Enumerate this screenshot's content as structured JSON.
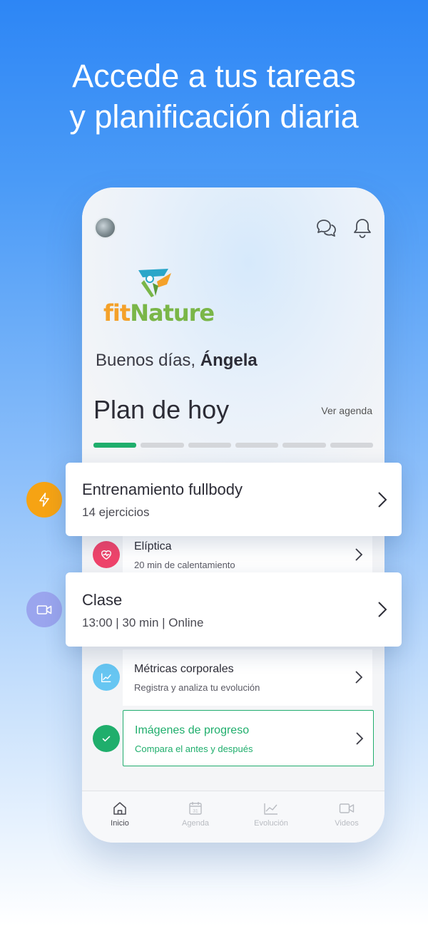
{
  "headline": {
    "line1": "Accede a tus tareas",
    "line2": "y planificación diaria"
  },
  "header": {
    "avatar": "avatar",
    "chat_icon": "chat-bubbles-icon",
    "bell_icon": "bell-icon"
  },
  "brand": {
    "logo_fit": "fit",
    "logo_nature": "Nature",
    "colors": {
      "orange": "#f4a12a",
      "green": "#7ab648",
      "teal": "#2aa6c9"
    }
  },
  "greeting": {
    "prefix": "Buenos días, ",
    "name": "Ángela"
  },
  "plan": {
    "title": "Plan de hoy",
    "link": "Ver agenda",
    "progress_total": 6,
    "progress_done": 1,
    "accent": "#1fae6c"
  },
  "featured_cards": [
    {
      "title": "Entrenamiento fullbody",
      "subtitle": "14 ejercicios",
      "icon": "lightning-icon",
      "color": "#f6a313"
    },
    {
      "title": "Clase",
      "subtitle": "13:00 | 30 min | Online",
      "icon": "video-camera-icon",
      "color": "#9aa5ee"
    }
  ],
  "tasks": [
    {
      "title": "Elíptica",
      "subtitle": "20 min de calentamiento",
      "icon": "heart-rate-icon",
      "color": "#f0446b"
    },
    {
      "title": "Métricas corporales",
      "subtitle": "Registra y analiza tu evolución",
      "icon": "trend-chart-icon",
      "color": "#67c6f2"
    },
    {
      "title": "Imágenes de progreso",
      "subtitle": "Compara el antes y después",
      "icon": "check-icon",
      "color": "#1fae6c",
      "highlighted": true
    }
  ],
  "tabs": [
    {
      "label": "Inicio",
      "icon": "home-icon",
      "active": true
    },
    {
      "label": "Agenda",
      "icon": "calendar-icon",
      "calendar_day": "31"
    },
    {
      "label": "Evolución",
      "icon": "line-chart-icon"
    },
    {
      "label": "Videos",
      "icon": "video-icon"
    }
  ]
}
